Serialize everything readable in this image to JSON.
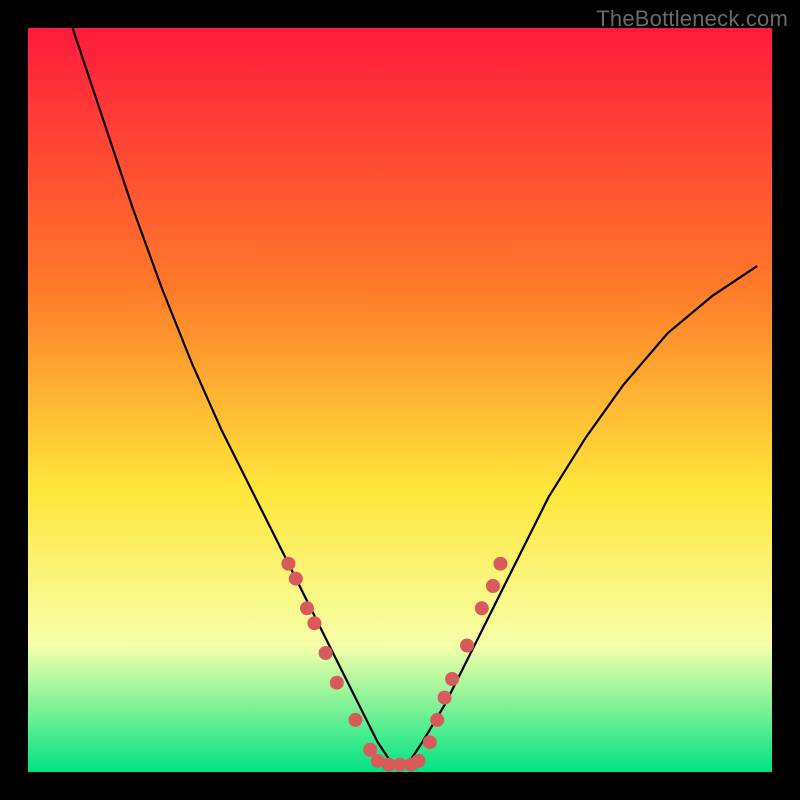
{
  "watermark": "TheBottleneck.com",
  "chart_data": {
    "type": "line",
    "title": "",
    "xlabel": "",
    "ylabel": "",
    "xlim": [
      0,
      100
    ],
    "ylim": [
      0,
      100
    ],
    "gradient_bg": {
      "top": "#ff1a3d",
      "upper_mid": "#ff7a2a",
      "mid": "#ffe63a",
      "lower_mid": "#f6ffaa",
      "bottom": "#00e383"
    },
    "series": [
      {
        "name": "bottleneck-curve",
        "color": "#000000",
        "x": [
          6,
          10,
          14,
          18,
          22,
          26,
          30,
          34,
          37,
          40,
          43,
          45,
          47,
          49,
          51,
          53,
          56,
          59,
          62,
          66,
          70,
          75,
          80,
          86,
          92,
          98
        ],
        "y": [
          100,
          88,
          76,
          65,
          55,
          46,
          38,
          30,
          24,
          18,
          12,
          8,
          4,
          1,
          1,
          4,
          9,
          15,
          21,
          29,
          37,
          45,
          52,
          59,
          64,
          68
        ]
      }
    ],
    "markers": {
      "name": "threshold-dots",
      "color": "#d95a5a",
      "radius": 7,
      "points": [
        {
          "x": 35,
          "y": 28
        },
        {
          "x": 36,
          "y": 26
        },
        {
          "x": 37.5,
          "y": 22
        },
        {
          "x": 38.5,
          "y": 20
        },
        {
          "x": 40,
          "y": 16
        },
        {
          "x": 41.5,
          "y": 12
        },
        {
          "x": 44,
          "y": 7
        },
        {
          "x": 46,
          "y": 3
        },
        {
          "x": 47,
          "y": 1.5
        },
        {
          "x": 48.5,
          "y": 1
        },
        {
          "x": 50,
          "y": 1
        },
        {
          "x": 51.5,
          "y": 1
        },
        {
          "x": 52.5,
          "y": 1.5
        },
        {
          "x": 54,
          "y": 4
        },
        {
          "x": 55,
          "y": 7
        },
        {
          "x": 56,
          "y": 10
        },
        {
          "x": 57,
          "y": 12.5
        },
        {
          "x": 59,
          "y": 17
        },
        {
          "x": 61,
          "y": 22
        },
        {
          "x": 62.5,
          "y": 25
        },
        {
          "x": 63.5,
          "y": 28
        }
      ]
    }
  }
}
